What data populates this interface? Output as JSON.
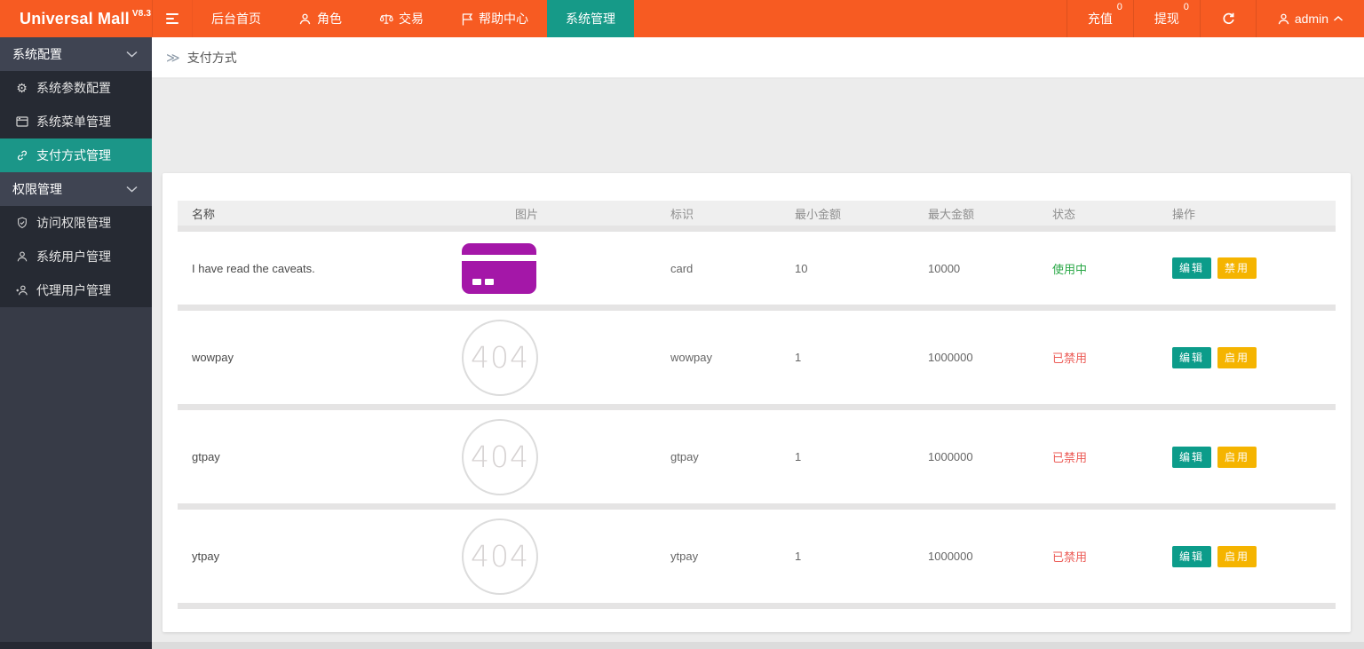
{
  "topbar": {
    "logo": "Universal Mall",
    "version": "V8.3",
    "nav": [
      {
        "label": "后台首页"
      },
      {
        "label": "角色"
      },
      {
        "label": "交易"
      },
      {
        "label": "帮助中心"
      },
      {
        "label": "系统管理"
      }
    ],
    "actions": {
      "recharge": {
        "label": "充值",
        "badge": "0"
      },
      "withdraw": {
        "label": "提现",
        "badge": "0"
      },
      "user": "admin"
    }
  },
  "sidebar": {
    "sections": [
      {
        "label": "系统配置",
        "items": [
          {
            "label": "系统参数配置"
          },
          {
            "label": "系统菜单管理"
          },
          {
            "label": "支付方式管理"
          }
        ]
      },
      {
        "label": "权限管理",
        "items": [
          {
            "label": "访问权限管理"
          },
          {
            "label": "系统用户管理"
          },
          {
            "label": "代理用户管理"
          }
        ]
      }
    ]
  },
  "breadcrumb": {
    "arrows": "≫",
    "current": "支付方式"
  },
  "table": {
    "headers": [
      "名称",
      "图片",
      "标识",
      "最小金额",
      "最大金额",
      "状态",
      "操作"
    ],
    "placeholder_text": "404",
    "rows": [
      {
        "name": "I have read the caveats.",
        "image": "card-icon",
        "tag": "card",
        "min": "10",
        "max": "10000",
        "status": "使用中",
        "status_type": "active",
        "actions": [
          "编辑",
          "禁用"
        ]
      },
      {
        "name": "wowpay",
        "image": "404",
        "tag": "wowpay",
        "min": "1",
        "max": "1000000",
        "status": "已禁用",
        "status_type": "disabled",
        "actions": [
          "编辑",
          "启用"
        ]
      },
      {
        "name": "gtpay",
        "image": "404",
        "tag": "gtpay",
        "min": "1",
        "max": "1000000",
        "status": "已禁用",
        "status_type": "disabled",
        "actions": [
          "编辑",
          "启用"
        ]
      },
      {
        "name": "ytpay",
        "image": "404",
        "tag": "ytpay",
        "min": "1",
        "max": "1000000",
        "status": "已禁用",
        "status_type": "disabled",
        "actions": [
          "编辑",
          "启用"
        ]
      }
    ]
  },
  "colors": {
    "topbar_orange": "#f75b22",
    "active_teal": "#169a88",
    "sidebar_dark": "#373b47",
    "status_active_green": "#28a745",
    "status_disabled_red": "#ec5b56",
    "edit_button": "#0c9c8a",
    "toggle_button": "#f5b400",
    "payment_card_purple": "#a417a8"
  }
}
